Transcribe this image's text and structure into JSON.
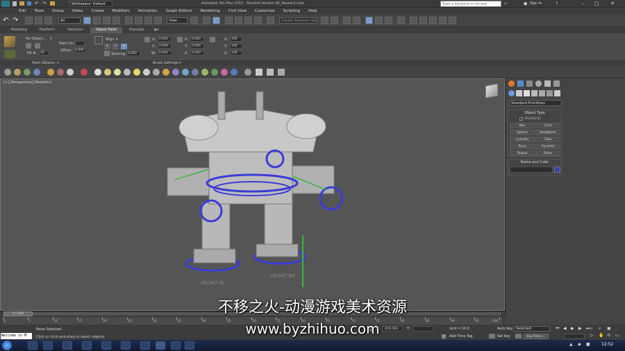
{
  "titlebar": {
    "workspace": "Workspace: Default",
    "title": "Autodesk 3ds Max 2015 - Student Version   08_Reaker2.max",
    "search_placeholder": "Type a keyword or phrase",
    "sign_in": "Sign In"
  },
  "menu": [
    "Edit",
    "Tools",
    "Group",
    "Views",
    "Create",
    "Modifiers",
    "Animation",
    "Graph Editors",
    "Rendering",
    "Civil View",
    "Customize",
    "Scripting",
    "Help"
  ],
  "toolbar": {
    "selection_filter": "All",
    "reference_coord": "View",
    "named_selection": "Create Selection Se"
  },
  "ribbon_tabs": [
    "Modeling",
    "Freeform",
    "Selection",
    "Object Paint",
    "Populate"
  ],
  "ribbon": {
    "no_object": "No Object...",
    "paint_on": "Paint On:",
    "offset_label": "Offset:",
    "offset_value": "0.000",
    "fill_label": "Fill #:",
    "fill_value": "10",
    "align_label": "Align",
    "spacing_label": "Spacing:",
    "spacing_value": "0.000",
    "u_label": "U:",
    "u_value": "0.000",
    "v_label": "V:",
    "v_value": "0.000",
    "w_label": "W:",
    "w_value": "0.000",
    "x_label": "X:",
    "x_value": "0.000",
    "y_label": "Y:",
    "y_value": "0.000",
    "z_label": "Z:",
    "z_value": "0.000",
    "sx_label": "X:",
    "sx_value": "100",
    "sy_label": "Y:",
    "sy_value": "100",
    "sz_label": "Z:",
    "sz_value": "100",
    "paint_objects": "Paint Objects",
    "brush_settings": "Brush Settings"
  },
  "viewport": {
    "label": "[+] [Perspective] [Realistic]",
    "ground_text_1": "FRONT RL",
    "ground_text_2": "FRONT RR"
  },
  "command_panel": {
    "dropdown": "Standard Primitives",
    "object_type_header": "Object Type",
    "autogrid": "AutoGrid",
    "buttons": [
      [
        "Box",
        "Cone"
      ],
      [
        "Sphere",
        "GeoSphere"
      ],
      [
        "Cylinder",
        "Tube"
      ],
      [
        "Torus",
        "Pyramid"
      ],
      [
        "Teapot",
        "Plane"
      ]
    ],
    "name_color_header": "Name and Color"
  },
  "timeline": {
    "frame": "0 / 100",
    "ticks": [
      "0",
      "5",
      "10",
      "15",
      "20",
      "25",
      "30",
      "35",
      "40",
      "45",
      "50",
      "55",
      "60",
      "65",
      "70",
      "75",
      "80",
      "85",
      "90",
      "95",
      "100"
    ]
  },
  "status": {
    "script_listener": "Welcome to M",
    "none_selected": "None Selected",
    "prompt": "Click or click-and-drag to select objects",
    "x_value": "-570.503",
    "grid": "Grid = 10.0",
    "add_time_tag": "Add Time Tag",
    "auto_key": "Auto Key",
    "selected": "Selected",
    "set_key": "Set Key",
    "key_filters": "Key Filters...",
    "clock": "12:52"
  },
  "watermark": {
    "line1": "不移之火-动漫游戏美术资源",
    "line2": "www.byzhihuo.com"
  },
  "colors": {
    "rig_blue": "#3b3bd8",
    "rig_green": "#3fb83f",
    "color_swatch": "#3344aa"
  }
}
